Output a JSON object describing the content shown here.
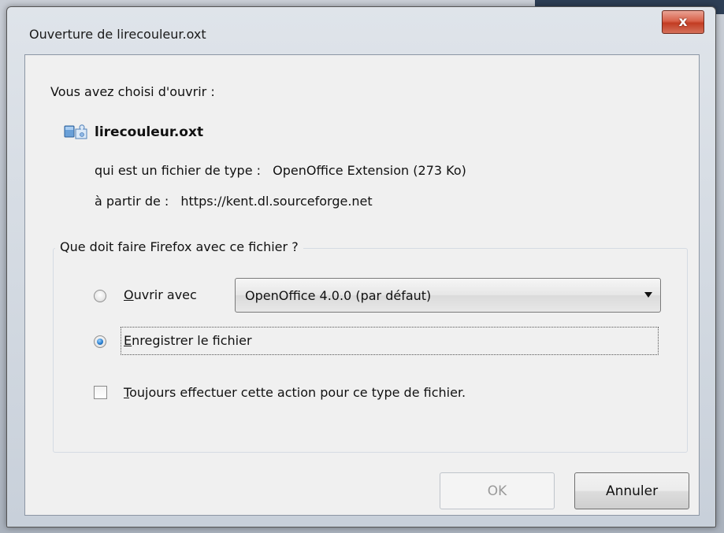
{
  "window": {
    "title": "Ouverture de lirecouleur.oxt",
    "close_glyph": "x"
  },
  "content": {
    "intro": "Vous avez choisi d'ouvrir :",
    "file_icon": "puzzle-extension-icon",
    "file_name": "lirecouleur.oxt",
    "type_label": "qui est un fichier de type :",
    "type_value": "OpenOffice Extension (273 Ko)",
    "from_label": "à partir de :",
    "from_value": "https://kent.dl.sourceforge.net"
  },
  "action_group": {
    "legend": "Que doit faire Firefox avec ce fichier ?",
    "open_with": {
      "label_first": "O",
      "label_rest": "uvrir avec",
      "selected": false,
      "app_select_value": "OpenOffice 4.0.0 (par défaut)"
    },
    "save_file": {
      "label_first": "E",
      "label_rest": "nregistrer le fichier",
      "selected": true
    },
    "always": {
      "label_first": "T",
      "label_rest": "oujours effectuer cette action pour ce type de fichier.",
      "checked": false
    }
  },
  "buttons": {
    "ok": "OK",
    "cancel": "Annuler"
  },
  "colors": {
    "close_button": "#c23c22",
    "radio_selected": "#2a7fd0",
    "dialog_background": "#f0f0f0"
  }
}
